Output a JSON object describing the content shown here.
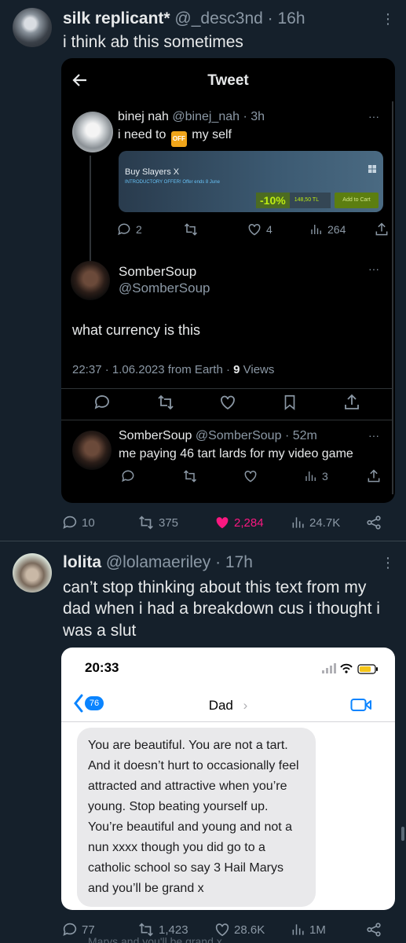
{
  "post1": {
    "display_name": "silk replicant*",
    "handle": "@_desc3nd",
    "time": "· 16h",
    "text": "i think ab this sometimes",
    "more_icon": "⋮",
    "screenshot": {
      "header_title": "Tweet",
      "reply1": {
        "name": "binej nah",
        "handle": "@binej_nah",
        "time": "· 3h",
        "text_before": "i need to",
        "emoji": "OFF",
        "text_after": "my self",
        "steam_card": {
          "title": "Buy Slayers X",
          "offer": "INTRODUCTORY OFFER! Offer ends 8 June",
          "discount": "-10%",
          "price": "148,50 TL",
          "cart": "Add to Cart"
        },
        "replies": "2",
        "likes": "4",
        "views": "264"
      },
      "main": {
        "name": "SomberSoup",
        "handle": "@SomberSoup",
        "text": "what currency is this",
        "meta": "22:37 · 1.06.2023 from Earth ·",
        "views_count": "9",
        "views_label": "Views"
      },
      "reply2": {
        "name": "SomberSoup",
        "handle": "@SomberSoup",
        "time": "· 52m",
        "text": "me paying 46 tart lards for my video game",
        "views": "3"
      },
      "more_dots": "···"
    },
    "stats": {
      "replies": "10",
      "retweets": "375",
      "likes": "2,284",
      "views": "24.7K"
    }
  },
  "post2": {
    "display_name": "lolita",
    "handle": "@lolamaeriley",
    "time": "· 17h",
    "text": "can’t stop thinking about this text from my dad when i had a breakdown cus i thought i was a slut",
    "more_icon": "⋮",
    "screenshot": {
      "time": "20:33",
      "badge": "76",
      "contact": "Dad",
      "message": "You are beautiful. You are not a tart. And it doesn’t hurt to occasionally feel attracted and attractive when you’re young. Stop beating yourself up. You’re beautiful and young and not a nun xxxx though you did go to a catholic school so say 3 Hail Marys and you’ll be grand x"
    },
    "stats": {
      "replies": "77",
      "retweets": "1,423",
      "likes": "28.6K",
      "views": "1M"
    },
    "cutoff_text": "Marys and you'll be grand x"
  },
  "colors": {
    "background": "#15202b",
    "like_pink": "#f91880",
    "muted": "#8b98a5"
  }
}
